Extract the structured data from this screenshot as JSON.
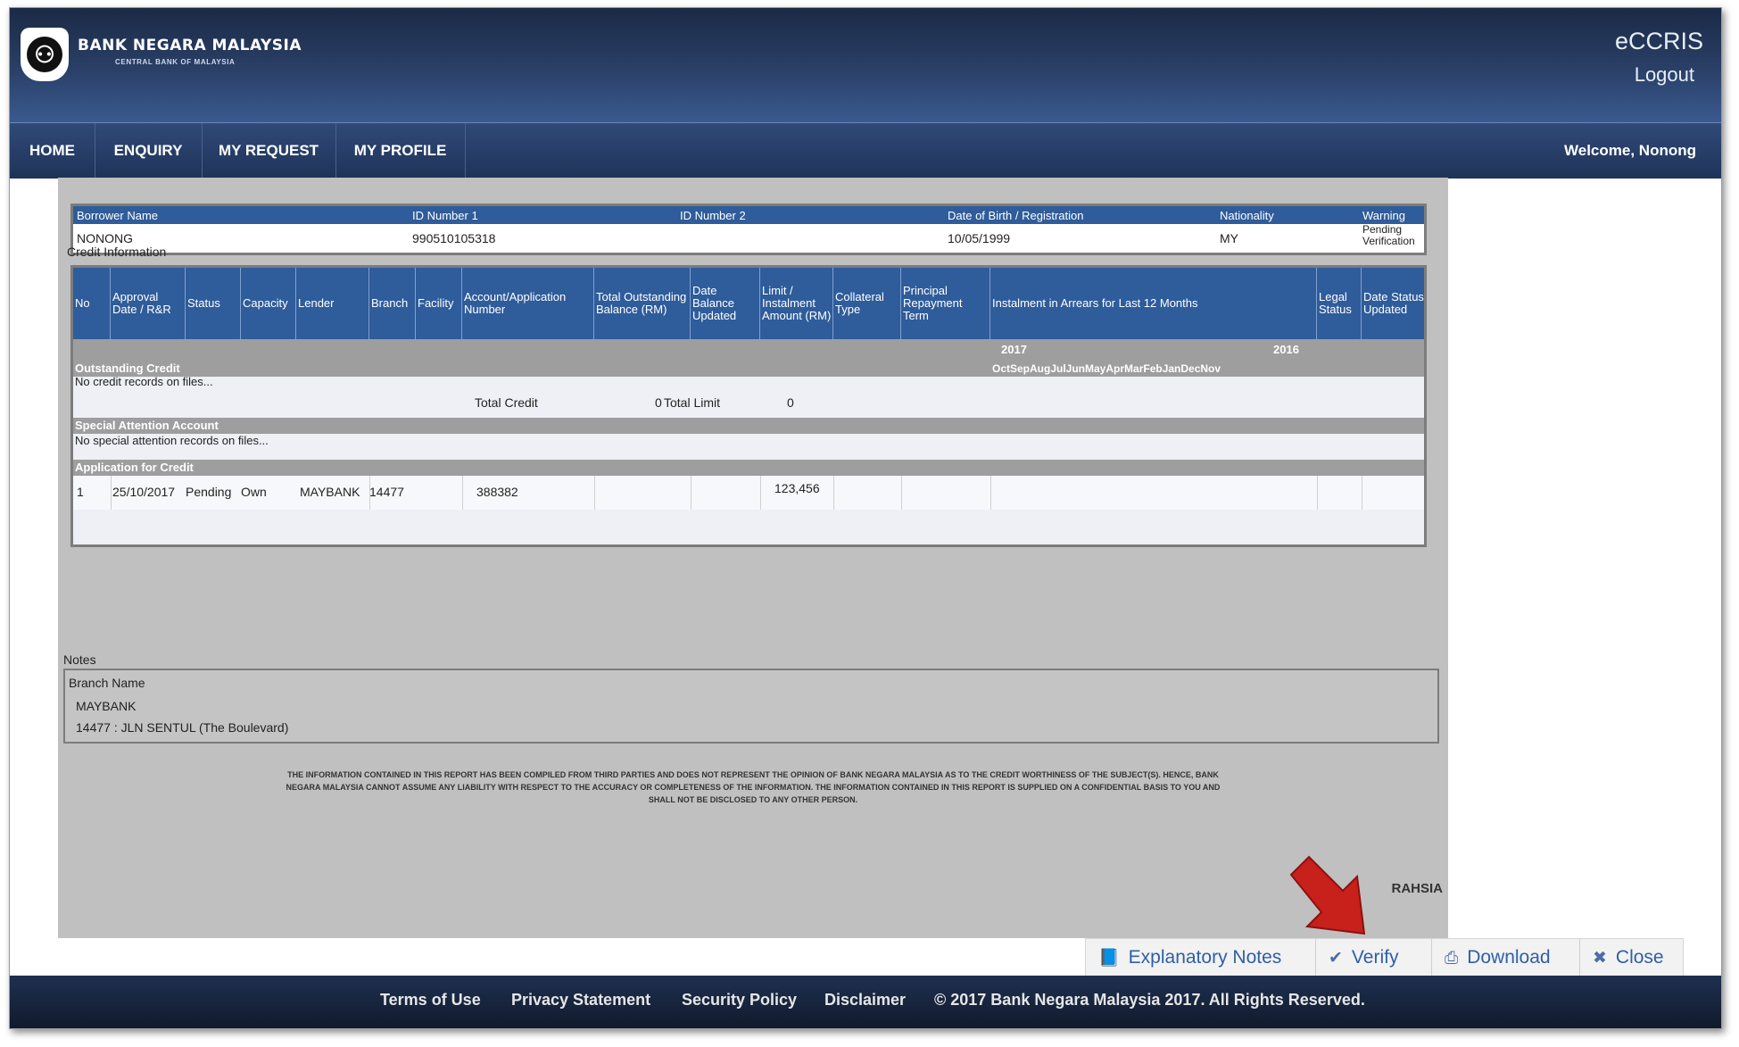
{
  "header": {
    "bank_name": "BANK NEGARA MALAYSIA",
    "bank_subtitle": "CENTRAL BANK OF MALAYSIA",
    "app_name": "eCCRIS",
    "logout_label": "Logout"
  },
  "nav": {
    "items": [
      {
        "label": "HOME"
      },
      {
        "label": "ENQUIRY"
      },
      {
        "label": "MY REQUEST"
      },
      {
        "label": "MY PROFILE"
      }
    ],
    "welcome": "Welcome, Nonong"
  },
  "borrower": {
    "headers": [
      "Borrower Name",
      "ID Number 1",
      "ID Number 2",
      "Date of Birth / Registration",
      "Nationality",
      "Warning"
    ],
    "values": {
      "name": "NONONG",
      "id1": "990510105318",
      "id2": "",
      "dob": "10/05/1999",
      "nationality": "MY",
      "warning": "Pending Verification"
    }
  },
  "credit": {
    "section_label": "Credit Information",
    "columns": [
      "No",
      "Approval Date / R&R",
      "Status",
      "Capacity",
      "Lender",
      "Branch",
      "Facility",
      "Account/Application Number",
      "Total Outstanding Balance (RM)",
      "Date Balance Updated",
      "Limit / Instalment Amount (RM)",
      "Collateral Type",
      "Principal Repayment Term",
      "Instalment in Arrears for Last 12 Months",
      "Legal Status",
      "Date Status Updated"
    ],
    "years": [
      "2017",
      "2016"
    ],
    "months": "OctSepAugJulJunMayAprMarFebJanDecNov",
    "outstanding": {
      "title": "Outstanding Credit",
      "empty": "No credit records on files...",
      "total_credit_label": "Total Credit",
      "total_credit_value": "0",
      "total_limit_label": "Total Limit",
      "total_limit_value": "0"
    },
    "special": {
      "title": "Special Attention Account",
      "empty": "No special attention records on files..."
    },
    "application": {
      "title": "Application for Credit",
      "row": {
        "no": "1",
        "date": "25/10/2017",
        "status": "Pending",
        "capacity": "Own",
        "lender": "MAYBANK",
        "branch": "14477",
        "account": "388382",
        "limit": "123,456"
      }
    }
  },
  "notes": {
    "label": "Notes",
    "heading": "Branch Name",
    "line1": "MAYBANK",
    "line2": "14477 : JLN SENTUL (The Boulevard)"
  },
  "disclaimer": {
    "line1": "THE INFORMATION CONTAINED IN THIS REPORT HAS BEEN COMPILED FROM THIRD PARTIES AND DOES NOT REPRESENT THE OPINION OF BANK NEGARA MALAYSIA AS TO THE CREDIT WORTHINESS OF THE SUBJECT(S). HENCE, BANK",
    "line2": "NEGARA MALAYSIA CANNOT ASSUME ANY LIABILITY WITH RESPECT TO THE ACCURACY OR COMPLETENESS OF THE INFORMATION. THE INFORMATION CONTAINED IN THIS REPORT IS SUPPLIED ON A CONFIDENTIAL BASIS TO YOU AND",
    "line3": "SHALL NOT BE DISCLOSED TO ANY OTHER PERSON."
  },
  "classification": "RAHSIA",
  "actions": {
    "explanatory": "Explanatory Notes",
    "verify": "Verify",
    "download": "Download",
    "close": "Close"
  },
  "footer": {
    "terms": "Terms of Use",
    "privacy": "Privacy Statement",
    "security": "Security Policy",
    "disclaimer": "Disclaimer",
    "copyright": "© 2017 Bank Negara Malaysia 2017. All Rights Reserved."
  },
  "colors": {
    "header_dark": "#1b2a45",
    "table_header": "#2f5c9a",
    "panel_bg": "#c0c0c0",
    "arrow": "#c8201a",
    "link": "#2f5fa6"
  }
}
